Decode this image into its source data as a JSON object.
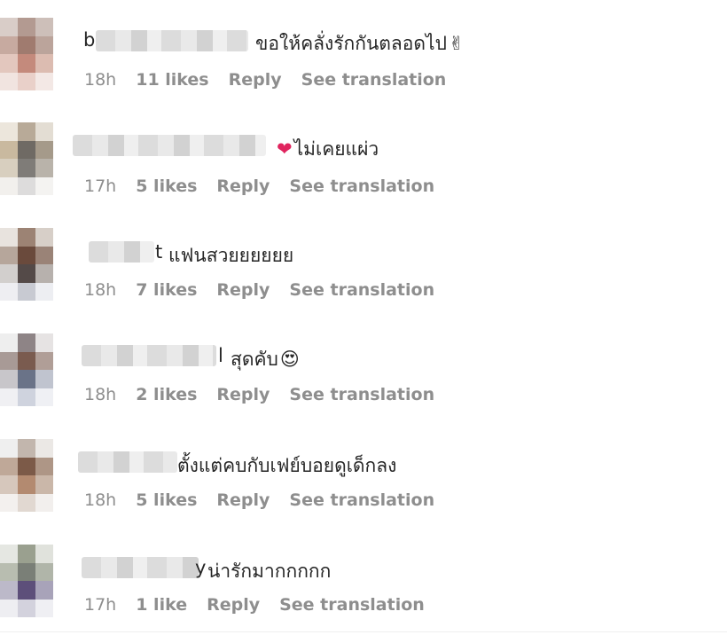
{
  "comments": [
    {
      "name_tail": "b",
      "text": "ขอให้คลั่งรักกันตลอดไป",
      "emoji": "peace-hand",
      "time": "18h",
      "likes": "11 likes",
      "reply": "Reply",
      "see_translation": "See translation"
    },
    {
      "name_tail": "",
      "text": "ไม่เคยแผ่ว",
      "emoji": "heart",
      "time": "17h",
      "likes": "5 likes",
      "reply": "Reply",
      "see_translation": "See translation"
    },
    {
      "name_tail": "t",
      "text": "แฟนสวยยยยยย",
      "emoji": "",
      "time": "18h",
      "likes": "7 likes",
      "reply": "Reply",
      "see_translation": "See translation"
    },
    {
      "name_tail": "l",
      "text": "สุดคับ",
      "emoji": "heart-eyes",
      "time": "18h",
      "likes": "2 likes",
      "reply": "Reply",
      "see_translation": "See translation"
    },
    {
      "name_tail": "",
      "text": "ตั้งแต่คบกับเฟย์บอยดูเด็กลง",
      "emoji": "",
      "time": "18h",
      "likes": "5 likes",
      "reply": "Reply",
      "see_translation": "See translation"
    },
    {
      "name_tail": "y",
      "text": "น่ารักมากกกกก",
      "emoji": "",
      "time": "17h",
      "likes": "1 like",
      "reply": "Reply",
      "see_translation": "See translation"
    }
  ],
  "colors": {
    "meta": "#8e8e8e",
    "text": "#262626",
    "heart": "#e0245e"
  }
}
